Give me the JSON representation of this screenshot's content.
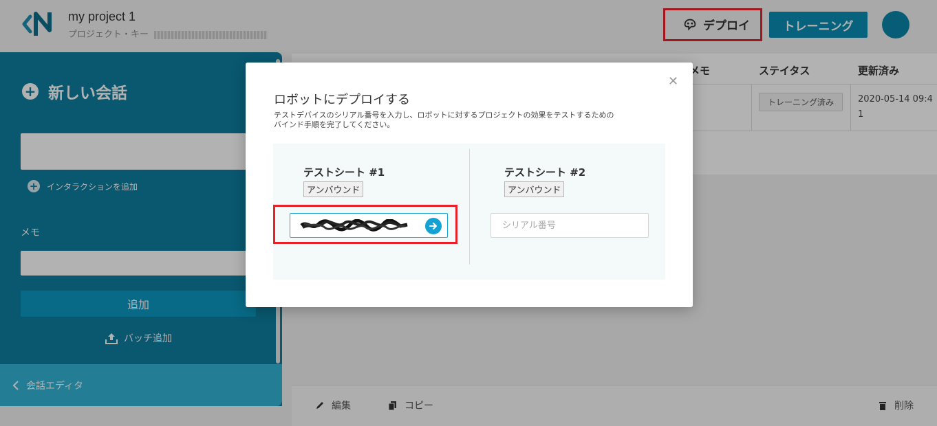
{
  "header": {
    "project_title": "my project 1",
    "project_key_label": "プロジェクト・キー",
    "deploy_label": "デプロイ",
    "training_label": "トレーニング"
  },
  "left_panel": {
    "new_conversation": "新しい会話",
    "add_interaction": "インタラクションを追加",
    "memo_label": "メモ",
    "add_button": "追加",
    "batch_add": "バッチ追加",
    "conversation_editor": "会話エディタ"
  },
  "table": {
    "headers": {
      "memo": "メモ",
      "status": "ステイタス",
      "updated": "更新済み"
    },
    "rows": [
      {
        "status": "トレーニング済み",
        "updated": "2020-05-14 09:41"
      }
    ]
  },
  "bottom_bar": {
    "edit": "編集",
    "copy": "コピー",
    "delete": "削除"
  },
  "modal": {
    "title": "ロボットにデプロイする",
    "description": "テストデバイスのシリアル番号を入力し、ロボットに対するプロジェクトの効果をテストするためのバインド手順を完了してください。",
    "seats": [
      {
        "title": "テストシート #1",
        "status": "アンバウンド"
      },
      {
        "title": "テストシート #2",
        "status": "アンバウンド",
        "placeholder": "シリアル番号"
      }
    ]
  },
  "colors": {
    "accent": "#0b8fb3",
    "panel": "#0e7ea0",
    "highlight_box": "#e8202a"
  }
}
